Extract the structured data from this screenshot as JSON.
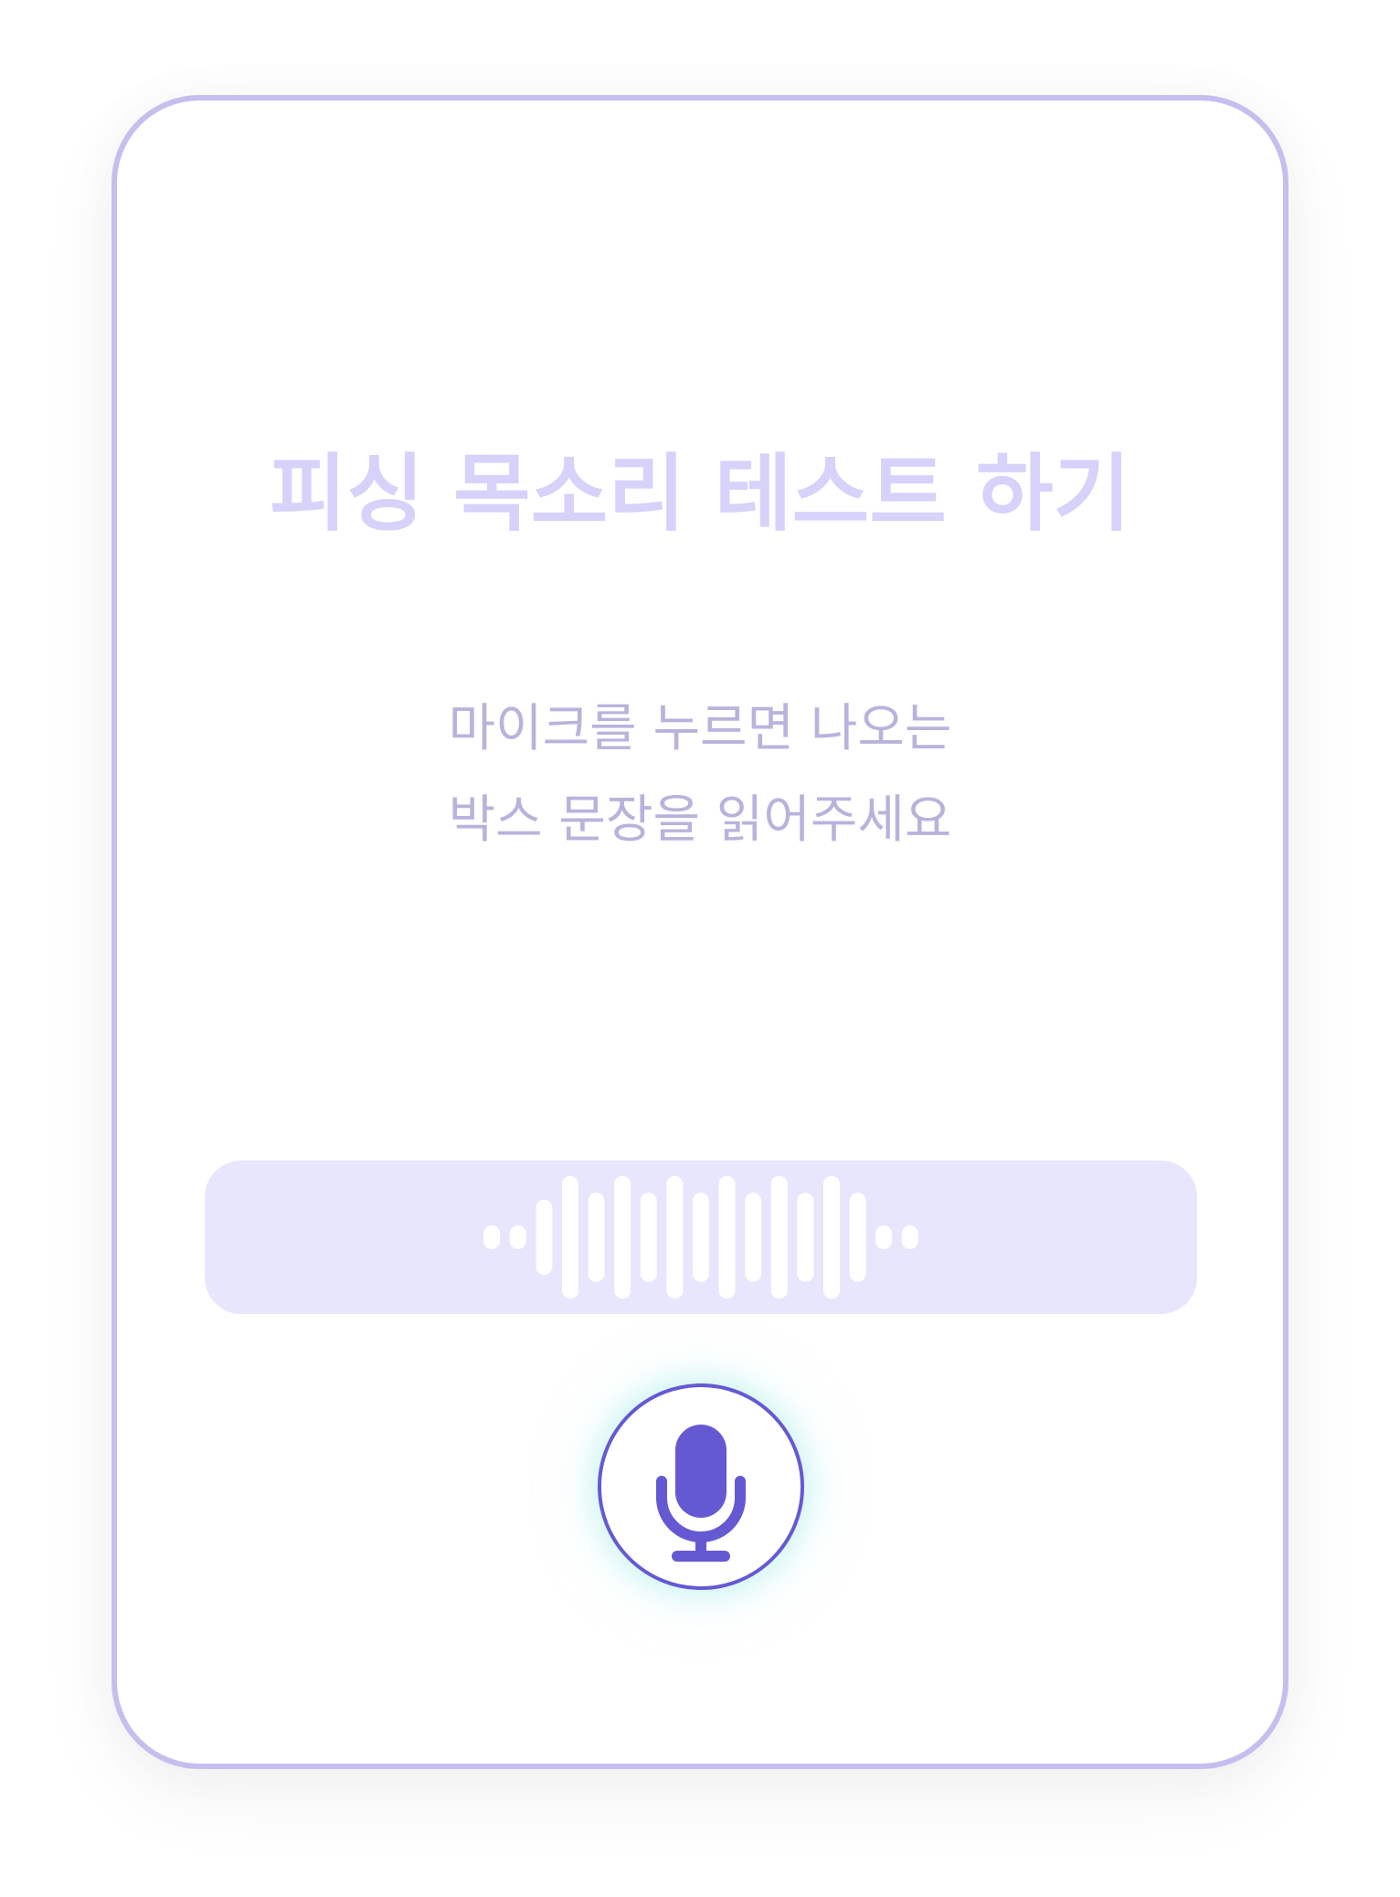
{
  "card": {
    "title": "피싱 목소리 테스트 하기",
    "instruction_lines": [
      "마이크를 누르면 나오는",
      "박스 문장을 읽어주세요"
    ]
  },
  "waveform": {
    "icon": "audio-waveform-icon",
    "bar_levels": [
      0.12,
      0.12,
      0.38,
      0.62,
      0.45,
      0.62,
      0.45,
      0.62,
      0.45,
      0.62,
      0.45,
      0.62,
      0.45,
      0.62,
      0.45,
      0.12,
      0.12
    ]
  },
  "mic": {
    "icon": "microphone-icon"
  },
  "colors": {
    "card_border": "#c4bfee",
    "title": "#d6d2fa",
    "instruction": "#b9b3dc",
    "wave_box": "#e8e6fd",
    "accent": "#6559d3"
  }
}
